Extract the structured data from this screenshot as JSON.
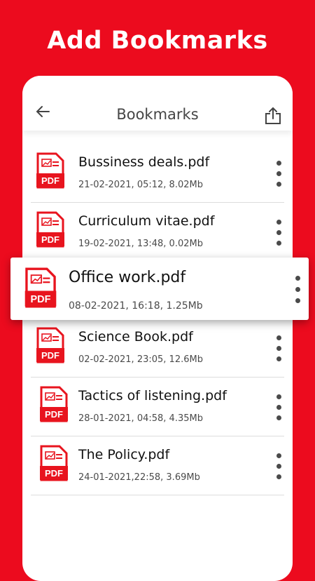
{
  "headline": "Add Bookmarks",
  "appbar": {
    "title": "Bookmarks",
    "back_icon": "arrow-left-icon",
    "share_icon": "share-icon"
  },
  "colors": {
    "background": "#ec0b1e",
    "pdf_icon": "#e8141e",
    "text": "#111111"
  },
  "files": [
    {
      "name": "Bussiness deals.pdf",
      "meta": "21-02-2021, 05:12, 8.02Mb"
    },
    {
      "name": "Curriculum vitae.pdf",
      "meta": "19-02-2021, 13:48, 0.02Mb"
    },
    {
      "name": "Office work.pdf",
      "meta": "08-02-2021, 16:18, 1.25Mb",
      "highlighted": true
    },
    {
      "name": "Science Book.pdf",
      "meta": "02-02-2021, 23:05, 12.6Mb"
    },
    {
      "name": "Tactics of listening.pdf",
      "meta": "28-01-2021, 04:58, 4.35Mb"
    },
    {
      "name": "The Policy.pdf",
      "meta": "24-01-2021,22:58, 3.69Mb"
    }
  ],
  "pdf_badge": "PDF"
}
